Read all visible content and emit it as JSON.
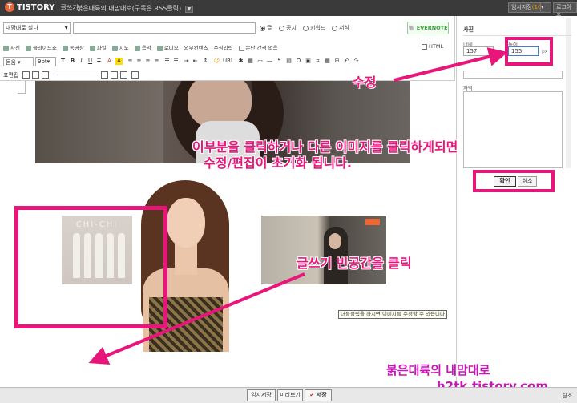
{
  "topbar": {
    "brand": "TISTORY",
    "brand_sub": "글쓰기",
    "blog_title": "붉은대륙의 내맘대로(구독은 RSS클릭)",
    "temp_save_label": "임시저장",
    "temp_save_count": "(10)",
    "logout": "로그아웃"
  },
  "editor": {
    "category": "내맘대로 살다",
    "title_value": "",
    "visibility_options": [
      "글",
      "공지",
      "키워드",
      "서식"
    ],
    "evernote": "EVERNOTE",
    "insert_tools": [
      "사진",
      "슬라이드쇼",
      "동영상",
      "파일",
      "지도",
      "음악",
      "로디오",
      "외부컨텐츠",
      "수식입력",
      "문단 간격 없음"
    ],
    "html_label": "HTML",
    "font_family": "돋움",
    "font_size": "9pt",
    "table_label": "표편집"
  },
  "content": {
    "album_text": "CHI-CHI",
    "tooltip": "더블클릭을 하시면 이미지를 수정할 수 있습니다"
  },
  "annotations": {
    "line1": "이부분을 클릭하거나 다른 이미지를 클릭하게되면",
    "line2": "수정/편집이 초기화 됩니다.",
    "click_blank": "글쓰기 빈공간을 클릭",
    "edit": "수정",
    "credit_name": "붉은대륙의 내맘대로",
    "credit_url": "h2tk.tistory.com"
  },
  "panel": {
    "title": "사진",
    "width_label": "너비",
    "width_value": "157",
    "height_label": "높이",
    "height_value": "155",
    "unit": "px",
    "caption_label": "자막",
    "ok": "확인",
    "cancel": "취소"
  },
  "footer": {
    "temp_save": "임시저장",
    "preview": "미리보기",
    "save": "저장",
    "close": "닫소"
  },
  "colors": {
    "annotation": "#e8157a",
    "credit": "#c715b8"
  }
}
